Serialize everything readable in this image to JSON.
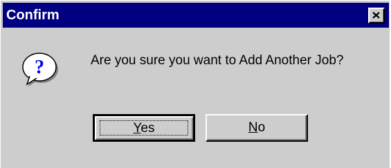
{
  "dialog": {
    "title": "Confirm",
    "close_icon": "close-icon",
    "message_icon": "question-icon",
    "message": "Are you sure you want to Add Another Job?",
    "buttons": [
      {
        "accel": "Y",
        "rest": "es",
        "default": true
      },
      {
        "accel": "N",
        "rest": "o",
        "default": false
      }
    ]
  },
  "colors": {
    "title_bar": "#000080",
    "face": "#cdcdcd",
    "icon_bubble": "#ffffff",
    "icon_glyph": "#0000ff"
  }
}
